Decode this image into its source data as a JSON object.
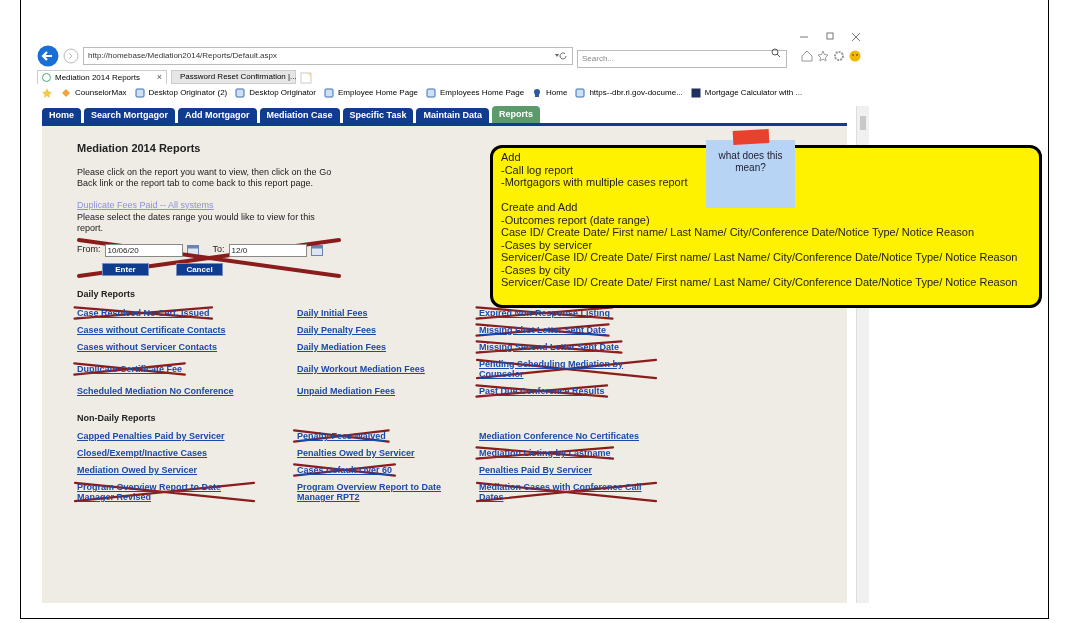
{
  "browser": {
    "address": "http://homebase/Mediation2014/Reports/Default.aspx",
    "search_placeholder": "Search...",
    "tabs": [
      {
        "label": "Mediation 2014 Reports",
        "selected": true,
        "close": "×"
      },
      {
        "label": "Password Reset Confirmation |...",
        "selected": false
      }
    ],
    "favorites": [
      "CounselorMax",
      "Desktop Originator (2)",
      "Desktop Originator",
      "Employee Home Page",
      "Employees Home Page",
      "Home",
      "https--dbr.ri.gov-docume...",
      "Mortgage Calculator with ..."
    ]
  },
  "app_tabs": [
    {
      "label": "Home",
      "selected": false
    },
    {
      "label": "Search Mortgagor",
      "selected": false
    },
    {
      "label": "Add Mortgagor",
      "selected": false
    },
    {
      "label": "Mediation Case",
      "selected": false
    },
    {
      "label": "Specific Task",
      "selected": false
    },
    {
      "label": "Maintain Data",
      "selected": false
    },
    {
      "label": "Reports",
      "selected": true
    }
  ],
  "page": {
    "title": "Mediation 2014 Reports",
    "intro": "Please click on the report you want to view, then click on the Go Back link or the report tab to come back to this report page.",
    "selected_report": "Duplicate Fees Paid -- All systems",
    "date_prompt": "Please select the dates range you would like to view for this report.",
    "date_form": {
      "crossed": true,
      "from_label": "From:",
      "from_value": "10/06/20",
      "to_label": "To:",
      "to_value": "12/0",
      "buttons": [
        "Enter",
        "Cancel"
      ]
    }
  },
  "sections": [
    {
      "heading": "Daily Reports",
      "items": [
        {
          "label": "Case Resolved No Cert. Issued",
          "crossed": true
        },
        {
          "label": "Daily Initial Fees",
          "crossed": false
        },
        {
          "label": "Expired Non-Response Listing",
          "crossed": true
        },
        {
          "label": "Cases without Certificate Contacts",
          "crossed": false
        },
        {
          "label": "Daily Penalty Fees",
          "crossed": false
        },
        {
          "label": "Missing First Letter Sent Date",
          "crossed": true
        },
        {
          "label": "Cases without Servicer Contacts",
          "crossed": false
        },
        {
          "label": "Daily Mediation Fees",
          "crossed": false
        },
        {
          "label": "Missing Second Letter Sent Date",
          "crossed": true
        },
        {
          "label": "Duplicate Certificate Fee",
          "crossed": true
        },
        {
          "label": "Daily Workout Mediation Fees",
          "crossed": false
        },
        {
          "label": "Pending Scheduling Mediation by Counselor",
          "crossed": true
        },
        {
          "label": "Scheduled Mediation No Conference",
          "crossed": false
        },
        {
          "label": "Unpaid Mediation Fees",
          "crossed": false
        },
        {
          "label": "Past Due Conference Results",
          "crossed": true
        }
      ]
    },
    {
      "heading": "Non-Daily Reports",
      "items": [
        {
          "label": "Capped Penalties Paid by Servicer",
          "crossed": false
        },
        {
          "label": "Penalty Fees Waived",
          "crossed": true
        },
        {
          "label": "Mediation Conference No Certificates",
          "crossed": false
        },
        {
          "label": "Closed/Exempt/Inactive Cases",
          "crossed": false
        },
        {
          "label": "Penalties Owed by Servicer",
          "crossed": false
        },
        {
          "label": "Mediation Listing by Lastname",
          "crossed": true
        },
        {
          "label": "Mediation Owed by Servicer",
          "crossed": false
        },
        {
          "label": "Cases Default Over 60",
          "crossed": true
        },
        {
          "label": "Penalties Paid By Servicer",
          "crossed": false
        },
        {
          "label": "Program Overview Report to Date Manager Revised",
          "crossed": true
        },
        {
          "label": "Program Overview Report to Date Manager RPT2",
          "crossed": false
        },
        {
          "label": "Mediation Cases with Conference Call Dates",
          "crossed": true
        }
      ]
    }
  ],
  "annotation": {
    "paragraphs": [
      [
        "Add",
        "-Call log report",
        "-Mortgagors with multiple cases report"
      ],
      [
        "Create and Add",
        "-Outcomes report (date range)",
        "Case ID/ Create Date/ First name/ Last Name/ City/Conference Date/Notice Type/ Notice Reason",
        "-Cases by servicer",
        "Servicer/Case ID/ Create Date/ First name/ Last Name/ City/Conference Date/Notice Type/ Notice Reason",
        "-Cases by city",
        "Servicer/Case ID/ Create Date/ First name/ Last Name/ City/Conference Date/Notice Type/ Notice Reason"
      ]
    ],
    "sticky_note": "what does this mean?"
  }
}
